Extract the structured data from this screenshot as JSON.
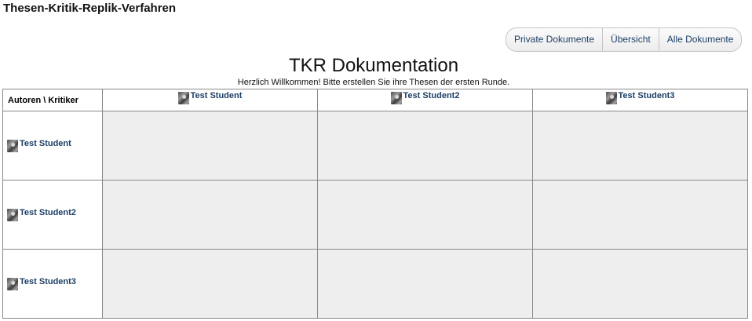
{
  "app": {
    "title": "Thesen-Kritik-Replik-Verfahren"
  },
  "nav": {
    "items": [
      {
        "label": "Private Dokumente"
      },
      {
        "label": "Übersicht"
      },
      {
        "label": "Alle Dokumente"
      }
    ]
  },
  "page": {
    "title": "TKR Dokumentation",
    "welcome": "Herzlich Willkommen! Bitte erstellen Sie ihre Thesen der ersten Runde."
  },
  "matrix": {
    "corner_label": "Autoren \\ Kritiker",
    "columns": [
      {
        "name": "Test Student"
      },
      {
        "name": "Test Student2"
      },
      {
        "name": "Test Student3"
      }
    ],
    "rows": [
      {
        "name": "Test Student"
      },
      {
        "name": "Test Student2"
      },
      {
        "name": "Test Student3"
      }
    ]
  },
  "icons": {
    "user_avatar": "user-avatar-icon"
  },
  "colors": {
    "link": "#1c3f66",
    "cell_background": "#eeeeee",
    "border": "#888888"
  }
}
